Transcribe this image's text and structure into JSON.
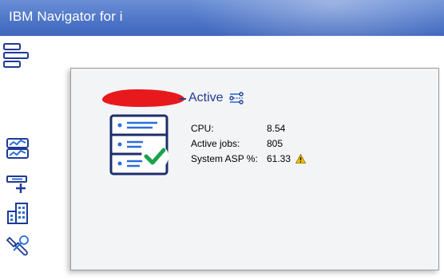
{
  "app": {
    "title": "IBM Navigator for i"
  },
  "rail": {
    "items": [
      {
        "icon": "dashboard-icon"
      },
      {
        "icon": "add-system-icon"
      },
      {
        "icon": "building-icon"
      },
      {
        "icon": "tools-icon"
      }
    ]
  },
  "system": {
    "status": "Active",
    "metrics": [
      {
        "label": "CPU:",
        "value": "8.54"
      },
      {
        "label": "Active jobs:",
        "value": "805"
      },
      {
        "label": "System ASP %:",
        "value": "61.33",
        "warning": true
      }
    ]
  },
  "colors": {
    "accent": "#1f3a93",
    "ok": "#1aa34a",
    "warning": "#f2c200",
    "titlebar": "#4f76c8"
  }
}
